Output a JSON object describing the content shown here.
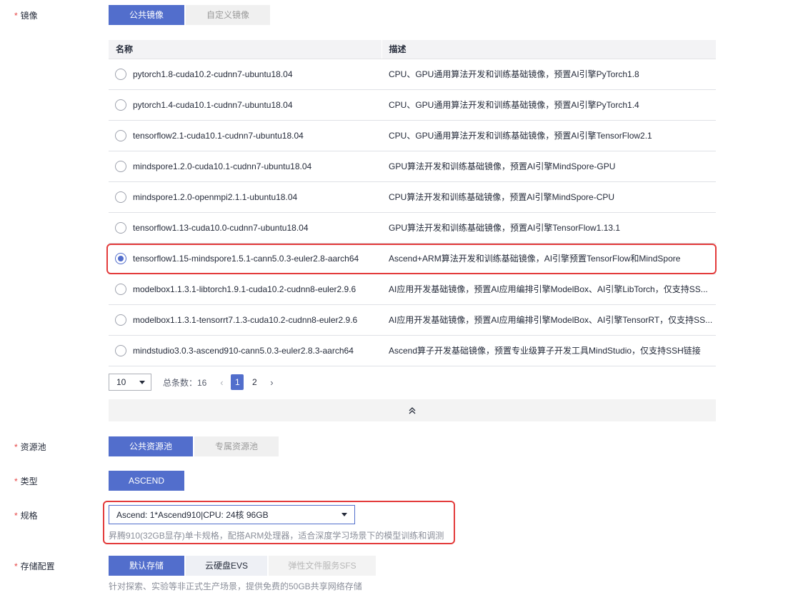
{
  "required_mark": "*",
  "image_section": {
    "label": "镜像",
    "tabs": [
      "公共镜像",
      "自定义镜像"
    ],
    "columns": [
      "名称",
      "描述"
    ],
    "rows": [
      {
        "name": "pytorch1.8-cuda10.2-cudnn7-ubuntu18.04",
        "desc": "CPU、GPU通用算法开发和训练基础镜像，预置AI引擎PyTorch1.8",
        "selected": false
      },
      {
        "name": "pytorch1.4-cuda10.1-cudnn7-ubuntu18.04",
        "desc": "CPU、GPU通用算法开发和训练基础镜像，预置AI引擎PyTorch1.4",
        "selected": false
      },
      {
        "name": "tensorflow2.1-cuda10.1-cudnn7-ubuntu18.04",
        "desc": "CPU、GPU通用算法开发和训练基础镜像，预置AI引擎TensorFlow2.1",
        "selected": false
      },
      {
        "name": "mindspore1.2.0-cuda10.1-cudnn7-ubuntu18.04",
        "desc": "GPU算法开发和训练基础镜像，预置AI引擎MindSpore-GPU",
        "selected": false
      },
      {
        "name": "mindspore1.2.0-openmpi2.1.1-ubuntu18.04",
        "desc": "CPU算法开发和训练基础镜像，预置AI引擎MindSpore-CPU",
        "selected": false
      },
      {
        "name": "tensorflow1.13-cuda10.0-cudnn7-ubuntu18.04",
        "desc": "GPU算法开发和训练基础镜像，预置AI引擎TensorFlow1.13.1",
        "selected": false
      },
      {
        "name": "tensorflow1.15-mindspore1.5.1-cann5.0.3-euler2.8-aarch64",
        "desc": "Ascend+ARM算法开发和训练基础镜像，AI引擎预置TensorFlow和MindSpore",
        "selected": true
      },
      {
        "name": "modelbox1.1.3.1-libtorch1.9.1-cuda10.2-cudnn8-euler2.9.6",
        "desc": "AI应用开发基础镜像，预置AI应用编排引擎ModelBox、AI引擎LibTorch，仅支持SS...",
        "selected": false
      },
      {
        "name": "modelbox1.1.3.1-tensorrt7.1.3-cuda10.2-cudnn8-euler2.9.6",
        "desc": "AI应用开发基础镜像，预置AI应用编排引擎ModelBox、AI引擎TensorRT，仅支持SS...",
        "selected": false
      },
      {
        "name": "mindstudio3.0.3-ascend910-cann5.0.3-euler2.8.3-aarch64",
        "desc": "Ascend算子开发基础镜像，预置专业级算子开发工具MindStudio，仅支持SSH链接",
        "selected": false
      }
    ],
    "pagination": {
      "page_size": "10",
      "total_label": "总条数：16",
      "pages": [
        "1",
        "2"
      ],
      "current_page": "1",
      "prev": "‹",
      "next": "›"
    },
    "collapse_icon": "double-chevron-up-icon"
  },
  "pool_section": {
    "label": "资源池",
    "tabs": [
      "公共资源池",
      "专属资源池"
    ]
  },
  "type_section": {
    "label": "类型",
    "value": "ASCEND"
  },
  "spec_section": {
    "label": "规格",
    "selected": "Ascend: 1*Ascend910|CPU: 24核 96GB",
    "hint": "昇腾910(32GB显存)单卡规格，配搭ARM处理器，适合深度学习场景下的模型训练和调测"
  },
  "storage_section": {
    "label": "存储配置",
    "tabs": [
      "默认存储",
      "云硬盘EVS",
      "弹性文件服务SFS"
    ],
    "hint": "针对探索、实验等非正式生产场景，提供免费的50GB共享网络存储"
  },
  "colors": {
    "accent": "#526ecc",
    "highlight": "#e33b3b",
    "required": "#e54545"
  }
}
